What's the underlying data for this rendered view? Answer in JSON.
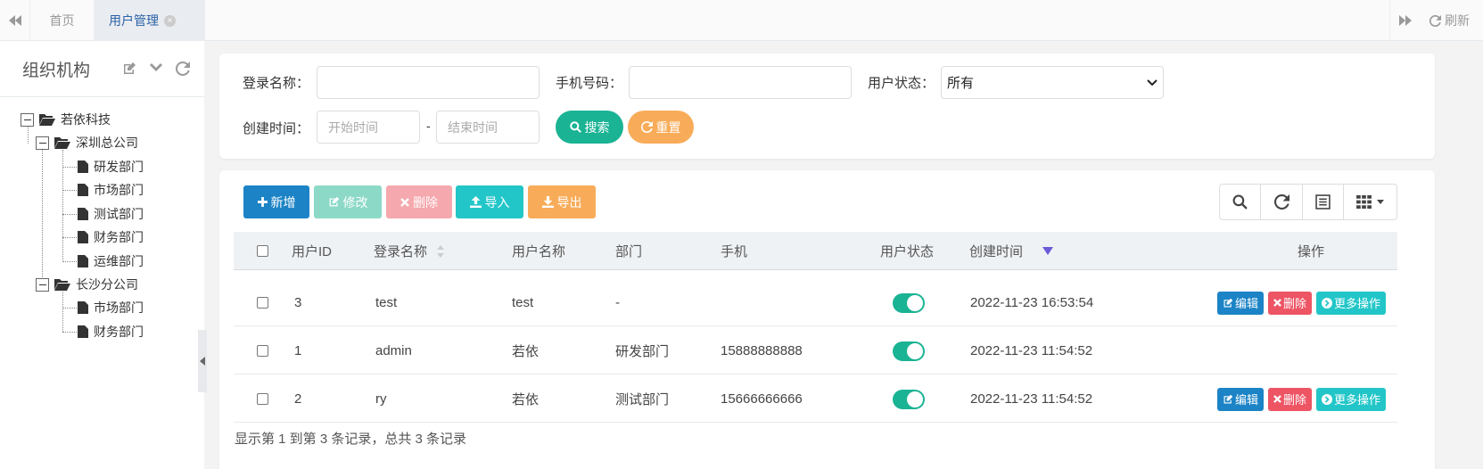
{
  "tabs": {
    "home": "首页",
    "active": "用户管理",
    "refresh": "刷新"
  },
  "sidebar": {
    "title": "组织机构",
    "tree": [
      {
        "label": "若依科技"
      },
      {
        "label": "深圳总公司"
      },
      {
        "label": "研发部门"
      },
      {
        "label": "市场部门"
      },
      {
        "label": "测试部门"
      },
      {
        "label": "财务部门"
      },
      {
        "label": "运维部门"
      },
      {
        "label": "长沙分公司"
      },
      {
        "label": "市场部门"
      },
      {
        "label": "财务部门"
      }
    ]
  },
  "search": {
    "login_name_label": "登录名称：",
    "phone_label": "手机号码：",
    "status_label": "用户状态：",
    "status_value": "所有",
    "created_label": "创建时间：",
    "start_placeholder": "开始时间",
    "end_placeholder": "结束时间",
    "range_sep": "-",
    "search_btn": "搜索",
    "reset_btn": "重置"
  },
  "toolbar": {
    "add": "新增",
    "edit": "修改",
    "delete": "删除",
    "import": "导入",
    "export": "导出"
  },
  "table": {
    "columns": [
      "用户ID",
      "登录名称",
      "用户名称",
      "部门",
      "手机",
      "用户状态",
      "创建时间",
      "操作"
    ],
    "rows": [
      {
        "id": "3",
        "login": "test",
        "name": "test",
        "dept": "-",
        "phone": "",
        "created": "2022-11-23 16:53:54",
        "actions": true
      },
      {
        "id": "1",
        "login": "admin",
        "name": "若依",
        "dept": "研发部门",
        "phone": "15888888888",
        "created": "2022-11-23 11:54:52",
        "actions": false
      },
      {
        "id": "2",
        "login": "ry",
        "name": "若依",
        "dept": "测试部门",
        "phone": "15666666666",
        "created": "2022-11-23 11:54:52",
        "actions": true
      }
    ],
    "action_edit": "编辑",
    "action_delete": "删除",
    "action_more": "更多操作"
  },
  "pager": {
    "summary": "显示第 1 到第 3 条记录，总共 3 条记录"
  },
  "colors": {
    "primary": "#1c84c6",
    "success": "#1ab394",
    "danger": "#ed5565",
    "info": "#23c6c8",
    "warning": "#f8ac59"
  }
}
